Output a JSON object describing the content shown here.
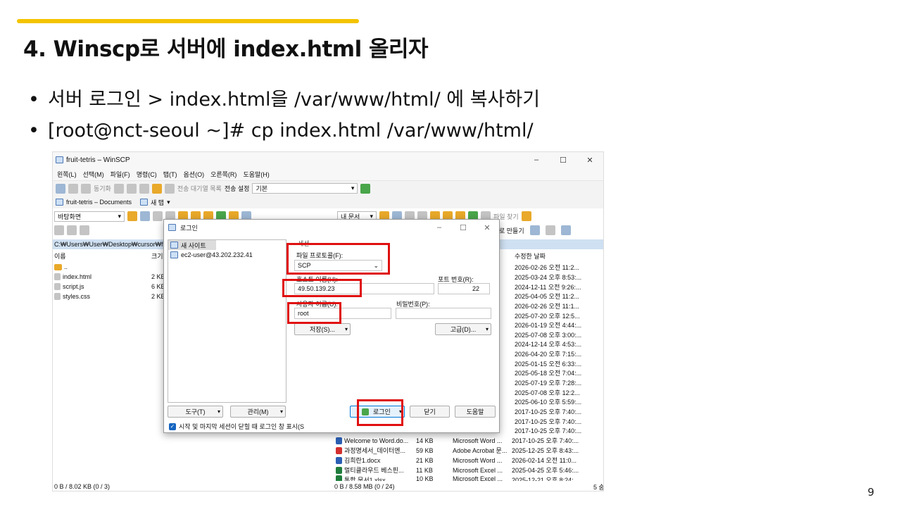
{
  "slide": {
    "title": "4. Winscp로 서버에 index.html 올리자",
    "bullets": [
      "서버 로그인 > index.html을 /var/www/html/ 에 복사하기",
      "[root@nct-seoul ~]# cp index.html /var/www/html/"
    ],
    "page_number": "9",
    "accent_color": "#f4c400"
  },
  "winscp": {
    "window_title": "fruit-tetris – WinSCP",
    "window_controls": [
      "–",
      "☐",
      "✕"
    ],
    "menu": [
      "왼쪽(L)",
      "선택(M)",
      "파일(F)",
      "명령(C)",
      "탭(T)",
      "옵션(O)",
      "오른쪽(R)",
      "도움말(H)"
    ],
    "toolbar": {
      "sync_label": "동기화",
      "queue_label": "전송 대기열 목록",
      "transfer_settings_label": "전송 설정",
      "transfer_settings_value": "기본"
    },
    "tabs": {
      "current": "fruit-tetris – Documents",
      "new_tab": "새 탭"
    },
    "left_panel": {
      "location": "바탕화면",
      "path": "C:₩Users₩User₩Desktop₩cursor₩fruit-",
      "columns": {
        "name": "이름",
        "size": "크기"
      },
      "files": [
        {
          "name": "..",
          "size": ""
        },
        {
          "name": "index.html",
          "size": "2 KB"
        },
        {
          "name": "script.js",
          "size": "6 KB"
        },
        {
          "name": "styles.css",
          "size": "2 KB"
        }
      ],
      "status": "0 B / 8.02 KB (0 / 3)"
    },
    "right_panel": {
      "location": "내 문서",
      "find_files": "파일 찾기",
      "new_label": "로 만들기",
      "modified_header": "수정한 날짜",
      "dates": [
        "2026-02-26 오전 11:2...",
        "2025-03-24 오후 8:53:...",
        "2024-12-11 오전 9:26:...",
        "2025-04-05 오전 11:2...",
        "2026-02-26 오전 11:1...",
        "2025-07-20 오후 12:5...",
        "2026-01-19 오전 4:44:...",
        "2025-07-08 오후 3:00:...",
        "2024-12-14 오후 4:53:...",
        "2026-04-20 오후 7:15:...",
        "2025-01-15 오전 6:33:...",
        "2025-05-18 오전 7:04:...",
        "2025-07-19 오후 7:28:...",
        "2025-07-08 오후 12:2...",
        "2025-06-10 오후 5:59:...",
        "2017-10-25 오후 7:40:...",
        "2017-10-25 오후 7:40:...",
        "2017-10-25 오후 7:40:..."
      ],
      "files": [
        {
          "name": "Welcome to Word.do...",
          "size": "14 KB",
          "type": "Microsoft Word ...",
          "date": "2017-10-25 오후 7:40:..."
        },
        {
          "name": "과정명세서_데이터엔...",
          "size": "59 KB",
          "type": "Adobe Acrobat 문...",
          "date": "2025-12-25 오후 8:43:..."
        },
        {
          "name": "김희란1.docx",
          "size": "21 KB",
          "type": "Microsoft Word ...",
          "date": "2026-02-14 오전 11:0..."
        },
        {
          "name": "멀티클라우드 베스핀...",
          "size": "11 KB",
          "type": "Microsoft Excel ...",
          "date": "2025-04-25 오후 5:46:..."
        },
        {
          "name": "통합 문서1.xlsx",
          "size": "10 KB",
          "type": "Microsoft Excel ...",
          "date": "2025-12-21 오후 8:24:..."
        }
      ],
      "status": "0 B / 8.58 MB (0 / 24)",
      "status_right": "5 숨"
    }
  },
  "login_dialog": {
    "title": "로그인",
    "sites": [
      "새 사이트",
      "ec2-user@43.202.232.41"
    ],
    "session_label": "세션",
    "protocol_label": "파일 프로토콜(F):",
    "protocol_value": "SCP",
    "host_label": "호스트 이름(H):",
    "host_value": "49.50.139.23",
    "port_label": "포트 번호(R):",
    "port_value": "22",
    "user_label": "사용자 이름(U):",
    "user_value": "root",
    "password_label": "비밀번호(P):",
    "password_value": "",
    "save_button": "저장(S)...",
    "advanced_button": "고급(D)...",
    "tools_button": "도구(T)",
    "manage_button": "관리(M)",
    "login_button": "로그인",
    "close_button": "닫기",
    "help_button": "도움말",
    "checkbox_label": "시작 및 마지막 세션이 닫힐 때 로그인 창 표시(S"
  },
  "highlight_color": "#e01010"
}
